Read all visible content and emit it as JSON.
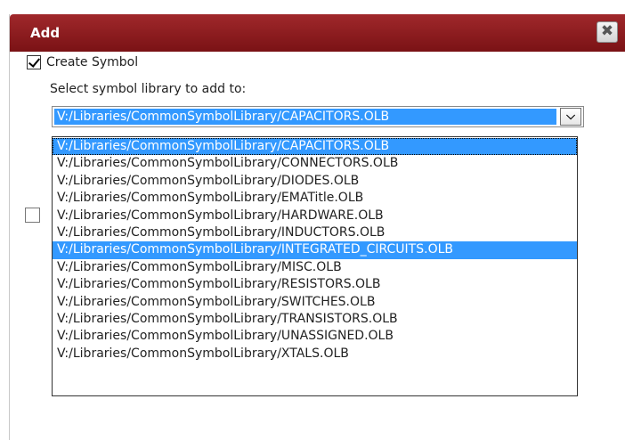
{
  "dialog": {
    "title": "Add",
    "close_glyph": "✖"
  },
  "create_symbol": {
    "label": "Create Symbol",
    "checked": true
  },
  "library": {
    "prompt": "Select symbol library to add to:",
    "selected": "V:/Libraries/CommonSymbolLibrary/CAPACITORS.OLB",
    "arrow_glyph": "⌵",
    "options": [
      "V:/Libraries/CommonSymbolLibrary/CAPACITORS.OLB",
      "V:/Libraries/CommonSymbolLibrary/CONNECTORS.OLB",
      "V:/Libraries/CommonSymbolLibrary/DIODES.OLB",
      "V:/Libraries/CommonSymbolLibrary/EMATitle.OLB",
      "V:/Libraries/CommonSymbolLibrary/HARDWARE.OLB",
      "V:/Libraries/CommonSymbolLibrary/INDUCTORS.OLB",
      "V:/Libraries/CommonSymbolLibrary/INTEGRATED_CIRCUITS.OLB",
      "V:/Libraries/CommonSymbolLibrary/MISC.OLB",
      "V:/Libraries/CommonSymbolLibrary/RESISTORS.OLB",
      "V:/Libraries/CommonSymbolLibrary/SWITCHES.OLB",
      "V:/Libraries/CommonSymbolLibrary/TRANSISTORS.OLB",
      "V:/Libraries/CommonSymbolLibrary/UNASSIGNED.OLB",
      "V:/Libraries/CommonSymbolLibrary/XTALS.OLB"
    ],
    "highlighted_index": 6,
    "current_index": 0
  },
  "colors": {
    "titlebar": "#8b1a1d",
    "selection": "#3399ff"
  }
}
